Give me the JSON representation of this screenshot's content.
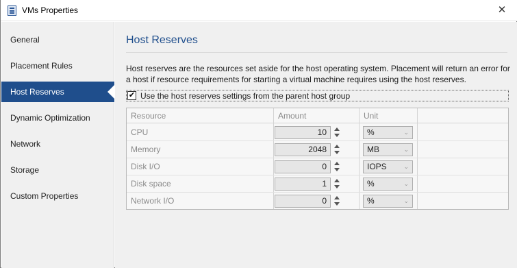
{
  "window": {
    "title": "VMs Properties",
    "close_glyph": "✕"
  },
  "sidebar": {
    "items": [
      {
        "label": "General"
      },
      {
        "label": "Placement Rules"
      },
      {
        "label": "Host Reserves"
      },
      {
        "label": "Dynamic Optimization"
      },
      {
        "label": "Network"
      },
      {
        "label": "Storage"
      },
      {
        "label": "Custom Properties"
      }
    ],
    "selected_index": 2
  },
  "main": {
    "title": "Host Reserves",
    "description": "Host reserves are the resources set aside for the host operating system.  Placement will return an error for a host if resource requirements for starting a virtual machine requires using the host reserves.",
    "use_parent": {
      "checked": true,
      "check_glyph": "✔",
      "label": "Use the host reserves settings from the parent host group"
    },
    "table": {
      "headers": {
        "resource": "Resource",
        "amount": "Amount",
        "unit": "Unit"
      },
      "rows": [
        {
          "resource": "CPU",
          "amount": "10",
          "unit": "%"
        },
        {
          "resource": "Memory",
          "amount": "2048",
          "unit": "MB"
        },
        {
          "resource": "Disk I/O",
          "amount": "0",
          "unit": "IOPS"
        },
        {
          "resource": "Disk space",
          "amount": "1",
          "unit": "%"
        },
        {
          "resource": "Network I/O",
          "amount": "0",
          "unit": "%"
        }
      ]
    }
  },
  "colors": {
    "accent": "#1f4e8c",
    "sidebar_bg": "#f0f0f0",
    "disabled_text": "#8a8a8a"
  },
  "icons": {
    "app": "vm-properties-icon",
    "close": "close-icon",
    "spin_up": "spin-up-icon",
    "spin_down": "spin-down-icon",
    "dropdown": "chevron-down-icon"
  }
}
